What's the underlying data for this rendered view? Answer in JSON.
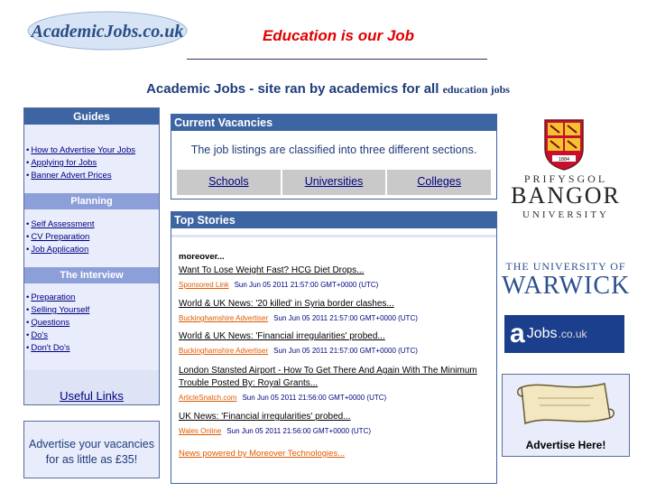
{
  "header": {
    "logo_text": "AcademicJobs.co.uk",
    "tagline": "Education is our Job",
    "heading_main": "Academic Jobs - site ran by academics for all",
    "heading_small": "education jobs"
  },
  "left": {
    "guides_title": "Guides",
    "guides": [
      "How to Advertise Your Jobs",
      "Applying for Jobs",
      "Banner Advert Prices"
    ],
    "planning_title": "Planning",
    "planning": [
      "Self Assessment",
      "CV Preparation",
      "Job Application"
    ],
    "interview_title": "The Interview",
    "interview": [
      "Preparation",
      "Selling Yourself",
      "Questions",
      "Do's",
      "Don't Do's"
    ],
    "useful_links": "Useful Links",
    "advertise_line1": "Advertise your vacancies",
    "advertise_line2": "for as little as £35!"
  },
  "vacancies": {
    "title": "Current Vacancies",
    "intro": "The job listings are classified into three different sections.",
    "sections": [
      "Schools",
      "Universities",
      "Colleges"
    ]
  },
  "stories": {
    "title": "Top Stories",
    "source_heading": "moreover...",
    "items": [
      {
        "title": "Want To Lose Weight Fast? HCG Diet Drops...",
        "source": "Sponsored Link",
        "date": "Sun Jun 05 2011 21:57:00 GMT+0000 (UTC)"
      },
      {
        "title": "World & UK News: '20 killed' in Syria border clashes...",
        "source": "Buckinghamshire Advertiser",
        "date": "Sun Jun 05 2011 21:57:00 GMT+0000 (UTC)"
      },
      {
        "title": "World & UK News: 'Financial irregularities' probed...",
        "source": "Buckinghamshire Advertiser",
        "date": "Sun Jun 05 2011 21:57:00 GMT+0000 (UTC)"
      },
      {
        "title": "London Stansted Airport - How To Get There And Again With The Minimum Trouble Posted By: Royal Grants...",
        "source": "ArticleSnatch.com",
        "date": "Sun Jun 05 2011 21:56:00 GMT+0000 (UTC)"
      },
      {
        "title": "UK News: 'Financial irregularities' probed...",
        "source": "Wales Online",
        "date": "Sun Jun 05 2011 21:56:00 GMT+0000 (UTC)"
      }
    ],
    "credit": "News powered by Moreover Technologies..."
  },
  "right": {
    "bangor_line1": "PRIFYSGOL",
    "bangor_line2": "BANGOR",
    "bangor_line3": "UNIVERSITY",
    "bangor_crest_year": "1884",
    "warwick_line1": "THE UNIVERSITY OF",
    "warwick_line2": "WARWICK",
    "ajobs_a": "a",
    "ajobs_jobs": "Jobs",
    "ajobs_tld": ".co.uk",
    "advertise_here": "Advertise Here!"
  }
}
